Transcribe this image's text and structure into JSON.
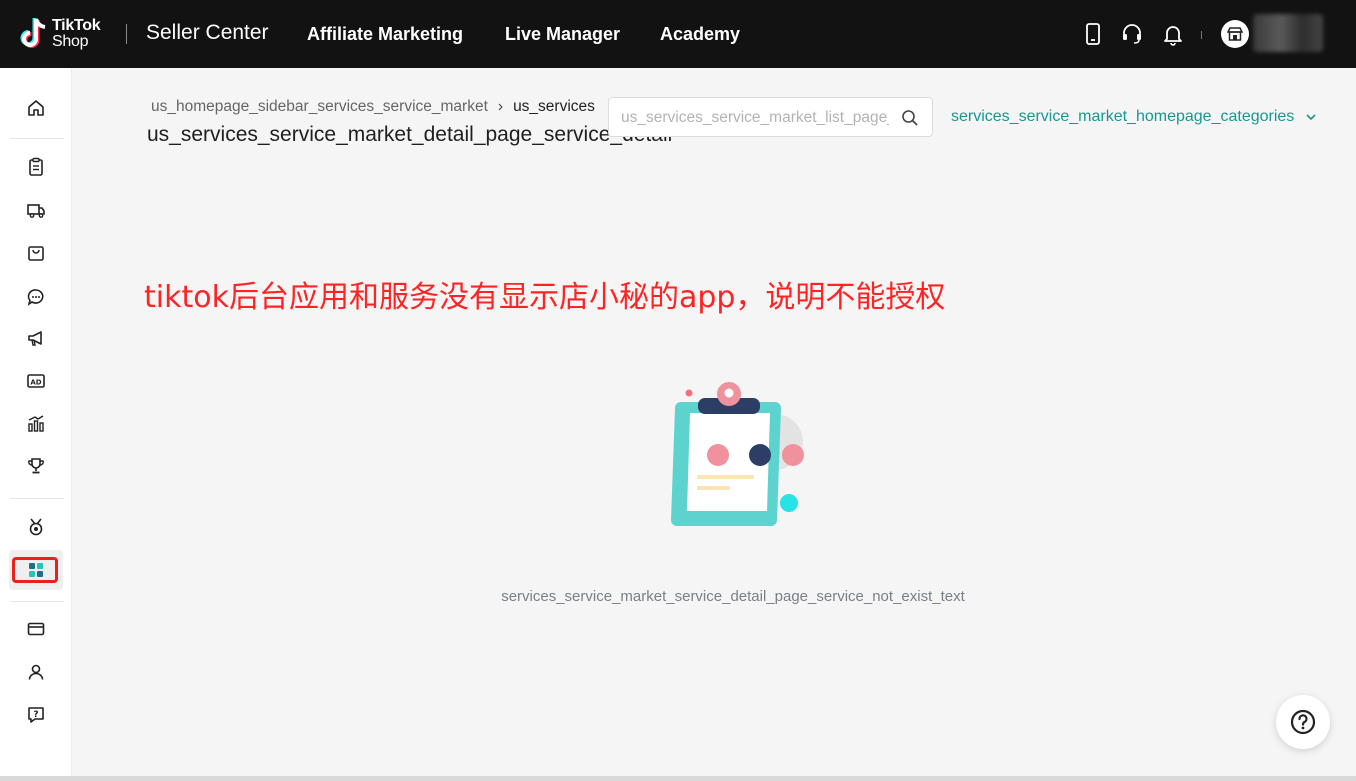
{
  "header": {
    "logo_line1": "TikTok",
    "logo_line2": "Shop",
    "app_title": "Seller Center",
    "nav": [
      {
        "label": "Affiliate Marketing"
      },
      {
        "label": "Live Manager"
      },
      {
        "label": "Academy"
      }
    ],
    "icons": [
      "phone-icon",
      "headset-icon",
      "bell-icon",
      "shop-avatar-icon"
    ]
  },
  "sidebar": {
    "icons": [
      "home-icon",
      "orders-icon",
      "shipping-icon",
      "products-icon",
      "chat-icon",
      "marketing-icon",
      "ads-icon",
      "analytics-icon",
      "trophy-icon",
      "growth-icon",
      "apps-services-icon",
      "finance-icon",
      "account-icon",
      "help-center-icon"
    ],
    "active": "apps-services-icon"
  },
  "breadcrumb": {
    "items": [
      "us_homepage_sidebar_services_service_market",
      "us_services"
    ]
  },
  "page": {
    "title": "us_services_service_market_detail_page_service_detail"
  },
  "search": {
    "placeholder": "us_services_service_market_list_page_search_placeholder",
    "value": ""
  },
  "categories": {
    "label": "services_service_market_homepage_categories"
  },
  "annotation": {
    "text": "tiktok后台应用和服务没有显示店小秘的app，说明不能授权"
  },
  "empty_state": {
    "text": "services_service_market_service_detail_page_service_not_exist_text"
  },
  "colors": {
    "accent": "#14998f",
    "topbar": "#121212",
    "annotation_red": "#ff2424"
  }
}
